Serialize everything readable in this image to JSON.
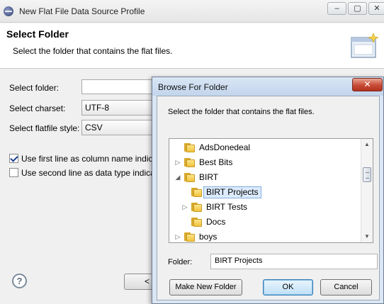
{
  "outer_window": {
    "title": "New Flat File Data Source Profile",
    "minimize_glyph": "–",
    "maximize_glyph": "▢",
    "close_glyph": "✕"
  },
  "wizard": {
    "title": "Select Folder",
    "description": "Select the folder that contains the flat files."
  },
  "form": {
    "folder_label": "Select folder:",
    "folder_value": "",
    "charset_label": "Select charset:",
    "charset_value": "UTF-8",
    "style_label": "Select flatfile style:",
    "style_value": "CSV",
    "first_line_label": "Use first line as column name indic",
    "first_line_checked": true,
    "second_line_label": "Use second line as data type indicat",
    "second_line_checked": false
  },
  "footer": {
    "help_glyph": "?",
    "back_label": "<"
  },
  "dialog": {
    "title": "Browse For Folder",
    "close_glyph": "✕",
    "description": "Select the folder that contains the flat files.",
    "tree": [
      {
        "label": "AdsDonedeal",
        "arrow": ""
      },
      {
        "label": "Best Bits",
        "arrow": "▷"
      },
      {
        "label": "BIRT",
        "arrow": "◢"
      },
      {
        "label": "BIRT Projects",
        "arrow": "",
        "selected": true
      },
      {
        "label": "BIRT Tests",
        "arrow": "▷"
      },
      {
        "label": "Docs",
        "arrow": ""
      },
      {
        "label": "boys",
        "arrow": "▷"
      }
    ],
    "scroll_up": "▲",
    "scroll_down": "▼",
    "folder_label": "Folder:",
    "folder_value": "BIRT Projects",
    "make_new_folder_label": "Make New Folder",
    "ok_label": "OK",
    "cancel_label": "Cancel"
  }
}
